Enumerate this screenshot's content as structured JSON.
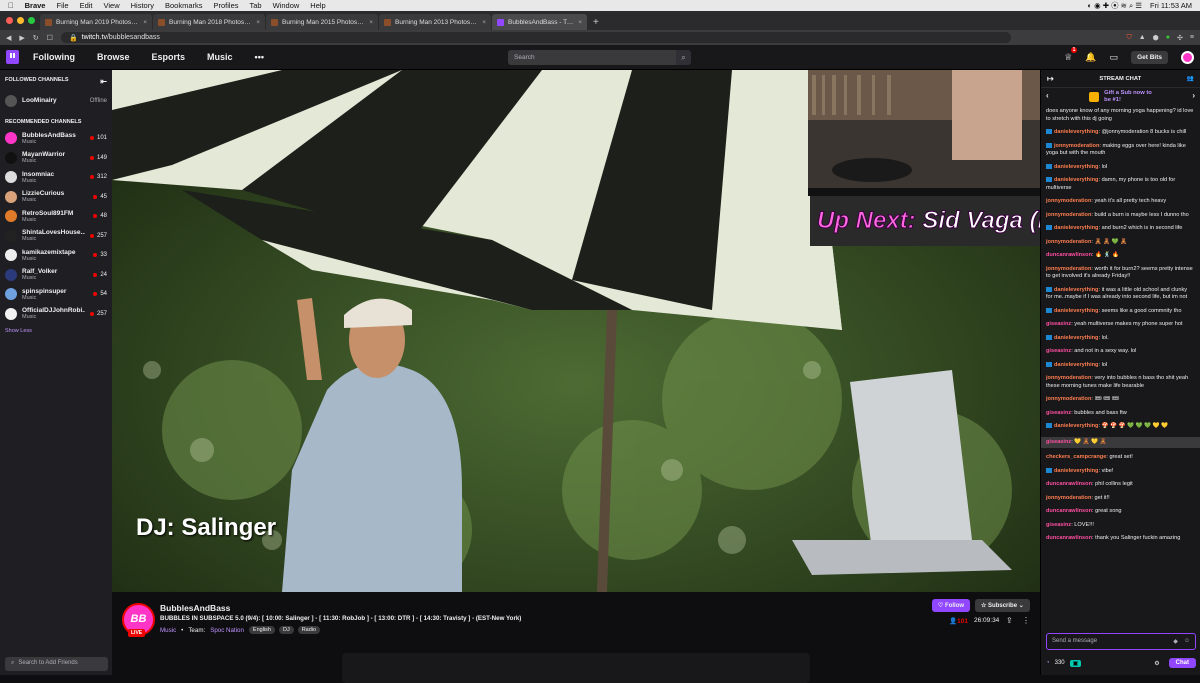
{
  "mac": {
    "apple": "",
    "app": "Brave",
    "menus": [
      "File",
      "Edit",
      "View",
      "History",
      "Bookmarks",
      "Profiles",
      "Tab",
      "Window",
      "Help"
    ],
    "clock": "Fri 11:53 AM"
  },
  "tabs": [
    {
      "label": "Burning Man 2019 Photos - Burn"
    },
    {
      "label": "Burning Man 2018 Photos - Burn"
    },
    {
      "label": "Burning Man 2015 Photos - Burn"
    },
    {
      "label": "Burning Man 2013 Photos - Burn"
    },
    {
      "label": "BubblesAndBass - Twitch",
      "active": true
    }
  ],
  "address": {
    "host": "twitch.tv",
    "path": "/bubblesandbass"
  },
  "nav": {
    "following": "Following",
    "browse": "Browse",
    "esports": "Esports",
    "music": "Music",
    "more": "•••",
    "search_placeholder": "Search",
    "notif_count": "1",
    "get_bits": "Get Bits"
  },
  "sidebar": {
    "followed_title": "FOLLOWED CHANNELS",
    "followed": [
      {
        "name": "LooMinairy",
        "status": "Offline",
        "color": "#555"
      }
    ],
    "recommended_title": "RECOMMENDED CHANNELS",
    "recommended": [
      {
        "name": "BubblesAndBass",
        "cat": "Music",
        "count": "101",
        "color": "#ff35c7"
      },
      {
        "name": "MayanWarrior",
        "cat": "Music",
        "count": "149",
        "color": "#111"
      },
      {
        "name": "Insomniac",
        "cat": "Music",
        "count": "312",
        "color": "#ddd"
      },
      {
        "name": "LizzieCurious",
        "cat": "Music",
        "count": "45",
        "color": "#d9a27a"
      },
      {
        "name": "RetroSoul891FM",
        "cat": "Music",
        "count": "48",
        "color": "#e07b2a"
      },
      {
        "name": "ShintaLovesHouse...",
        "cat": "Music",
        "count": "257",
        "color": "#222"
      },
      {
        "name": "kamikazemixtape",
        "cat": "Music",
        "count": "33",
        "color": "#eee"
      },
      {
        "name": "Ralf_Volker",
        "cat": "Music",
        "count": "24",
        "color": "#2b3a7a"
      },
      {
        "name": "spinspinsuper",
        "cat": "Music",
        "count": "54",
        "color": "#6fa0e0"
      },
      {
        "name": "OfficialDJJohnRobi...",
        "cat": "Music",
        "count": "257",
        "color": "#f2f2f2"
      }
    ],
    "show_less": "Show Less",
    "search_friends": "Search to Add Friends"
  },
  "video": {
    "overlay_upnext": "Up Next:",
    "overlay_artist": "Sid Vaga (N",
    "dj_label": "DJ: Salinger"
  },
  "channel": {
    "avatar_text": "BB",
    "live": "LIVE",
    "name": "BubblesAndBass",
    "title": "BUBBLES IN SUBSPACE 5.0 (9/4): [ 10:00: Salinger ] - [ 11:30: RobJob ] - [ 13:00: DTR ] - [ 14:30: Travisty ] - (EST-New York)",
    "category": "Music",
    "team_label": "Team:",
    "team": "Spoc Nation",
    "tags": [
      "English",
      "DJ",
      "Radio"
    ],
    "follow": "Follow",
    "subscribe": "Subscribe",
    "viewers": "101",
    "uptime": "26:09:34"
  },
  "chat": {
    "title": "STREAM CHAT",
    "gift_line1": "Gift a Sub now to",
    "gift_line2": "be #1!",
    "messages": [
      {
        "user": "",
        "text": "does anyone know of any morning yoga happening? id love to stretch with this dj going",
        "color": "#efeff1",
        "badge": false
      },
      {
        "user": "danieleverything",
        "text": "@jonnymoderation 8 bucks is chill",
        "color": "#ff7f50",
        "badge": true
      },
      {
        "user": "jonnymoderation",
        "text": "making eggs over here! kinda like yoga but with the mouth",
        "color": "#ff7f50",
        "badge": true
      },
      {
        "user": "danieleverything",
        "text": "lol",
        "color": "#ff7f50",
        "badge": true
      },
      {
        "user": "danieleverything",
        "text": "damn, my phone is too old for multiverse",
        "color": "#ff7f50",
        "badge": true
      },
      {
        "user": "jonnymoderation",
        "text": "yeah it's all pretty tech heavy",
        "color": "#ff7f50",
        "badge": false
      },
      {
        "user": "jonnymoderation",
        "text": "build a burn is maybe less I dunno tho",
        "color": "#ff7f50",
        "badge": false
      },
      {
        "user": "danieleverything",
        "text": "and burn2 which is in second life",
        "color": "#ff7f50",
        "badge": true
      },
      {
        "user": "jonnymoderation",
        "text": "🧸 🧸 💚 🧸",
        "color": "#ff7f50",
        "badge": false
      },
      {
        "user": "duncanrawlinson",
        "text": "🔥 🕺 🔥",
        "color": "#ff4fa0",
        "badge": false
      },
      {
        "user": "jonnymoderation",
        "text": "worth it for burn2? seems pretty intense to get involved it's already Friday!!",
        "color": "#ff7f50",
        "badge": false
      },
      {
        "user": "danieleverything",
        "text": "it was a little old school and clunky for me..maybe if I was already into second life, but im not",
        "color": "#ff7f50",
        "badge": true
      },
      {
        "user": "danieleverything",
        "text": "seems like a good commnity tho",
        "color": "#ff7f50",
        "badge": true
      },
      {
        "user": "giseasinz",
        "text": "yeah multiverse makes my phone super hot",
        "color": "#ff4fa0",
        "badge": false
      },
      {
        "user": "danieleverything",
        "text": "lol.",
        "color": "#ff7f50",
        "badge": true
      },
      {
        "user": "giseasinz",
        "text": "and not in a sexy way. lol",
        "color": "#ff4fa0",
        "badge": false
      },
      {
        "user": "danieleverything",
        "text": "lol",
        "color": "#ff7f50",
        "badge": true
      },
      {
        "user": "jonnymoderation",
        "text": "very into bubbles n bass tho shit yeah these morning tunes make life bearable",
        "color": "#ff7f50",
        "badge": false
      },
      {
        "user": "jonnymoderation",
        "text": "🎟 🎟 🎟",
        "color": "#ff7f50",
        "badge": false
      },
      {
        "user": "giseasinz",
        "text": "bubbles and bass ftw",
        "color": "#ff4fa0",
        "badge": false
      },
      {
        "user": "danieleverything",
        "text": "🍄 🍄 🍄 💚 💚 💚 💛 💛",
        "color": "#ff7f50",
        "badge": true
      },
      {
        "user": "giseasinz",
        "text": "💛 🧸 💛 🧸",
        "color": "#ff4fa0",
        "badge": false,
        "highlight": true
      },
      {
        "user": "checkers_campcrange",
        "text": "great set!",
        "color": "#ff7f50",
        "badge": false
      },
      {
        "user": "danieleverything",
        "text": "vibe!",
        "color": "#ff7f50",
        "badge": true
      },
      {
        "user": "duncanrawlinson",
        "text": "phil collins legit",
        "color": "#ff4fa0",
        "badge": false
      },
      {
        "user": "jonnymoderation",
        "text": "get it!!",
        "color": "#ff7f50",
        "badge": false
      },
      {
        "user": "duncanrawlinson",
        "text": "great song",
        "color": "#ff4fa0",
        "badge": false
      },
      {
        "user": "giseasinz",
        "text": "LOVE!!!",
        "color": "#ff4fa0",
        "badge": false
      },
      {
        "user": "duncanrawlinson",
        "text": "thank you Salinger fuckin amazing",
        "color": "#ff4fa0",
        "badge": false
      }
    ],
    "input_placeholder": "Send a message",
    "points": "330",
    "chat_button": "Chat"
  }
}
